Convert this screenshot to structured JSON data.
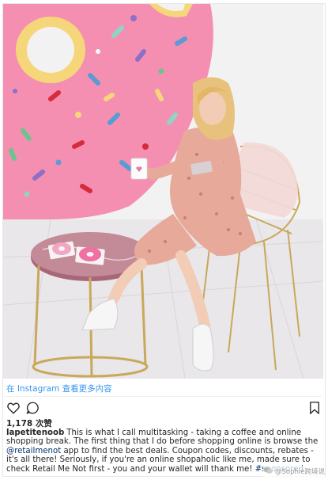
{
  "post": {
    "image_alt": "Woman in floral dress sitting on a gold wire chair holding a coffee cup and phone, marble side table with donuts, pink donut mural on the wall",
    "view_more_label": "在 Instagram 查看更多内容",
    "likes_label": "1,178 次赞",
    "caption": {
      "username": "lapetitenoob",
      "text_before_mention": "This is what I call multitasking - taking a coffee and online shopping break. The first thing that I do before shopping online is browse the ",
      "mention": "@retailmenot",
      "text_after_mention": " app to find the best deals. Coupon codes, discounts, rebates - it's all there! Seriously, if you're an online shopaholic like me, made sure to check Retail Me Not first - you and your wallet will thank me! ",
      "hashtag": "#sponsored"
    },
    "icons": {
      "like": "heart-outline-icon",
      "comment": "speech-bubble-icon",
      "save": "bookmark-icon"
    }
  },
  "watermark": {
    "text": "@Sophie跨境说"
  },
  "colors": {
    "link_blue": "#3897f0",
    "mural_pink": "#f58fb1",
    "text_dark": "#262626"
  }
}
